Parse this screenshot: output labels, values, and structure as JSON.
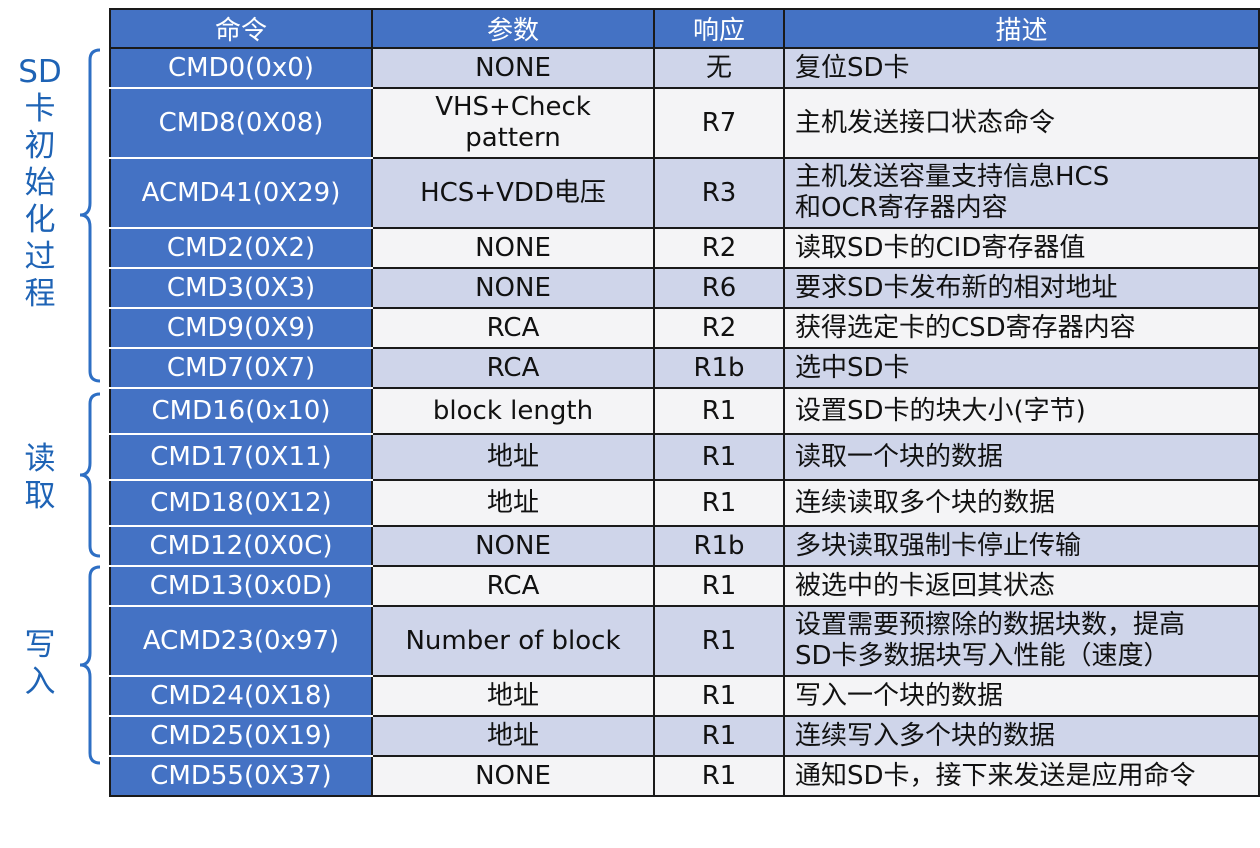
{
  "groups": [
    {
      "label": "SD\n卡\n初\n始\n化\n过\n程"
    },
    {
      "label": "读\n取"
    },
    {
      "label": "写\n入"
    }
  ],
  "colors": {
    "header_bg": "#4472c4",
    "row_odd": "#cfd5ea",
    "row_even": "#f4f4f6",
    "label": "#1e63b5"
  },
  "table": {
    "headers": [
      "命令",
      "参数",
      "响应",
      "描述"
    ],
    "rows": [
      [
        "CMD0(0x0)",
        "NONE",
        "无",
        "复位SD卡"
      ],
      [
        "CMD8(0X08)",
        "VHS+Check\npattern",
        "R7",
        "主机发送接口状态命令"
      ],
      [
        "ACMD41(0X29)",
        "HCS+VDD电压",
        "R3",
        "主机发送容量支持信息HCS\n和OCR寄存器内容"
      ],
      [
        "CMD2(0X2)",
        "NONE",
        "R2",
        "读取SD卡的CID寄存器值"
      ],
      [
        "CMD3(0X3)",
        "NONE",
        "R6",
        "要求SD卡发布新的相对地址"
      ],
      [
        "CMD9(0X9)",
        "RCA",
        "R2",
        "获得选定卡的CSD寄存器内容"
      ],
      [
        "CMD7(0X7)",
        "RCA",
        "R1b",
        "选中SD卡"
      ],
      [
        "CMD16(0x10)",
        "block length",
        "R1",
        "设置SD卡的块大小(字节)"
      ],
      [
        "CMD17(0X11)",
        "地址",
        "R1",
        "读取一个块的数据"
      ],
      [
        "CMD18(0X12)",
        "地址",
        "R1",
        "连续读取多个块的数据"
      ],
      [
        "CMD12(0X0C)",
        "NONE",
        "R1b",
        "多块读取强制卡停止传输"
      ],
      [
        "CMD13(0x0D)",
        "RCA",
        "R1",
        "被选中的卡返回其状态"
      ],
      [
        "ACMD23(0x97)",
        "Number of block",
        "R1",
        "设置需要预擦除的数据块数，提高\nSD卡多数据块写入性能（速度）"
      ],
      [
        "CMD24(0X18)",
        "地址",
        "R1",
        "写入一个块的数据"
      ],
      [
        "CMD25(0X19)",
        "地址",
        "R1",
        "连续写入多个块的数据"
      ],
      [
        "CMD55(0X37)",
        "NONE",
        "R1",
        "通知SD卡，接下来发送是应用命令"
      ]
    ]
  }
}
